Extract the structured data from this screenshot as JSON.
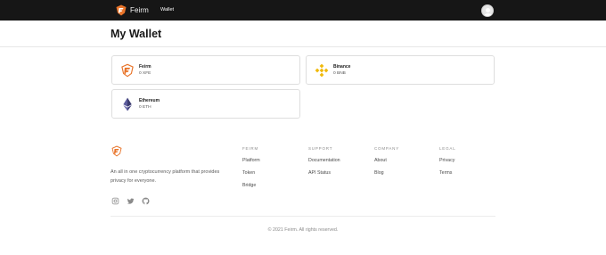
{
  "header": {
    "brand": "Feirm",
    "nav": {
      "wallet": "Wallet"
    },
    "brand_color": "#e8742a"
  },
  "main": {
    "title": "My Wallet",
    "wallets": [
      {
        "name": "Feirm",
        "balance": "0 XFE",
        "icon": "feirm-logo-icon",
        "color": "#e8742a"
      },
      {
        "name": "Binance",
        "balance": "0 BNB",
        "icon": "binance-logo-icon",
        "color": "#f0b90b"
      },
      {
        "name": "Ethereum",
        "balance": "0 ETH",
        "icon": "ethereum-logo-icon",
        "color": "#3c3c6e"
      }
    ]
  },
  "footer": {
    "description": "An all in one cryptocurrency platform that provides privacy for everyone.",
    "social": [
      "instagram-icon",
      "twitter-icon",
      "github-icon"
    ],
    "columns": [
      {
        "heading": "FEIRM",
        "links": [
          "Platform",
          "Token",
          "Bridge"
        ]
      },
      {
        "heading": "SUPPORT",
        "links": [
          "Documentation",
          "API Status"
        ]
      },
      {
        "heading": "COMPANY",
        "links": [
          "About",
          "Blog"
        ]
      },
      {
        "heading": "LEGAL",
        "links": [
          "Privacy",
          "Terms"
        ]
      }
    ],
    "copyright": "© 2021 Feirm. All rights reserved."
  }
}
